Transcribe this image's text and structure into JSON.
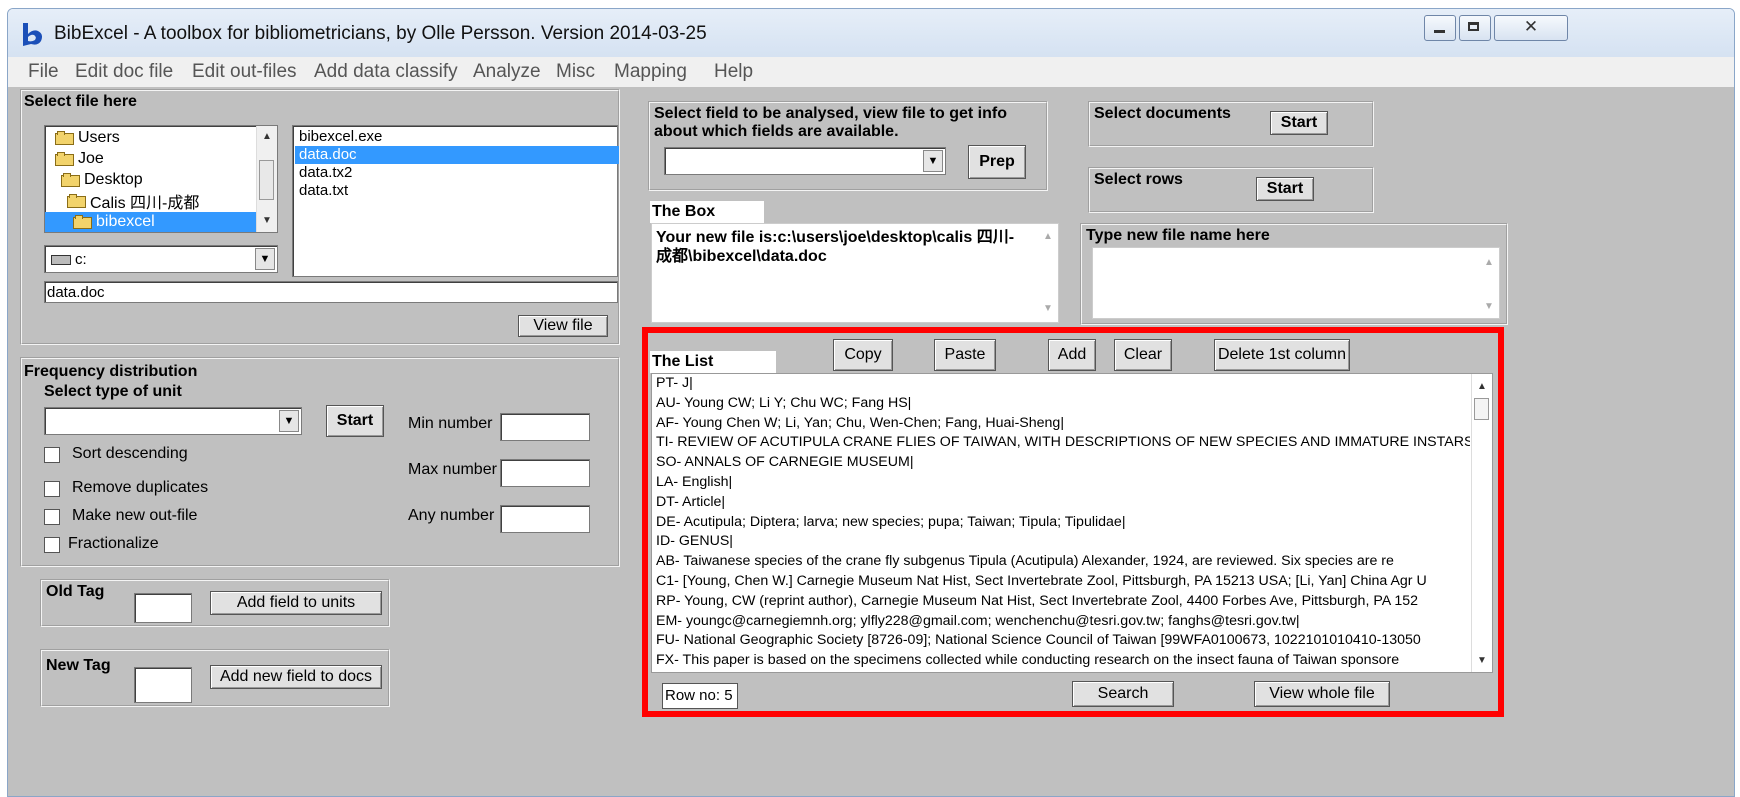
{
  "window": {
    "title": "BibExcel - A toolbox for bibliometricians, by Olle Persson. Version 2014-03-25"
  },
  "menu": [
    "File",
    "Edit doc file",
    "Edit out-files",
    "Add data classify",
    "Analyze",
    "Misc",
    "Mapping",
    "Help"
  ],
  "select_file": {
    "heading": "Select file here",
    "folders": [
      "Users",
      "Joe",
      "Desktop",
      "Calis 四川-成都",
      "bibexcel"
    ],
    "selected_folder": "bibexcel",
    "files": [
      "bibexcel.exe",
      "data.doc",
      "data.tx2",
      "data.txt"
    ],
    "selected_file": "data.doc",
    "drive": "c:",
    "filename": "data.doc",
    "view_file_button": "View file"
  },
  "frequency": {
    "heading": "Frequency distribution",
    "unit_label": "Select type of unit",
    "unit_value": "",
    "start_button": "Start",
    "checkboxes": [
      "Sort descending",
      "Remove duplicates",
      "Make new out-file",
      "Fractionalize"
    ],
    "min_label": "Min number",
    "max_label": "Max number",
    "any_label": "Any number"
  },
  "old_tag": {
    "label": "Old Tag",
    "value": "",
    "button": "Add field to units"
  },
  "new_tag": {
    "label": "New Tag",
    "value": "",
    "button": "Add new field to docs"
  },
  "select_field": {
    "label": "Select field to be analysed, view file to get info about which fields are available.",
    "value": "",
    "prep_button": "Prep"
  },
  "select_documents": {
    "label": "Select documents",
    "button": "Start"
  },
  "select_rows": {
    "label": "Select rows",
    "button": "Start"
  },
  "the_box": {
    "heading": "The Box",
    "text": "Your new file is:c:\\users\\joe\\desktop\\calis 四川-成都\\bibexcel\\data.doc"
  },
  "new_file_name": {
    "heading": "Type new file name here",
    "value": ""
  },
  "the_list": {
    "heading": "The List",
    "buttons": {
      "copy": "Copy",
      "paste": "Paste",
      "add": "Add",
      "clear": "Clear",
      "delete_first_column": "Delete 1st column"
    },
    "lines": [
      "PT- J|",
      "AU- Young CW; Li Y; Chu WC; Fang HS|",
      "AF- Young Chen W; Li, Yan; Chu, Wen-Chen; Fang, Huai-Sheng|",
      "TI- REVIEW OF ACUTIPULA CRANE FLIES OF TAIWAN, WITH DESCRIPTIONS OF NEW SPECIES AND IMMATURE INSTARS (",
      "SO- ANNALS OF CARNEGIE MUSEUM|",
      "LA- English|",
      "DT- Article|",
      "DE- Acutipula; Diptera; larva; new species; pupa; Taiwan; Tipula; Tipulidae|",
      "ID- GENUS|",
      "AB- Taiwanese species of the crane fly subgenus Tipula (Acutipula) Alexander, 1924, are reviewed. Six species are re",
      "C1- [Young, Chen W.] Carnegie Museum Nat Hist, Sect Invertebrate Zool, Pittsburgh, PA 15213 USA; [Li, Yan] China Agr U",
      "RP- Young, CW (reprint author), Carnegie Museum Nat Hist, Sect Invertebrate Zool, 4400 Forbes Ave, Pittsburgh, PA 152",
      "EM- youngc@carnegiemnh.org; ylfly228@gmail.com; wenchenchu@tesri.gov.tw; fanghs@tesri.gov.tw|",
      "FU- National Geographic Society [8726-09]; National Science Council of Taiwan [99WFA0100673, 1022101010410-13050",
      "FX- This paper is based on the specimens collected while conducting research on the insect fauna of Taiwan sponsore"
    ],
    "row_no": "Row no: 5",
    "search_button": "Search",
    "view_whole_button": "View whole file"
  },
  "colors": {
    "selection": "#3399ff",
    "highlight_border": "#ff0000",
    "client_bg": "#c0c0c0"
  }
}
